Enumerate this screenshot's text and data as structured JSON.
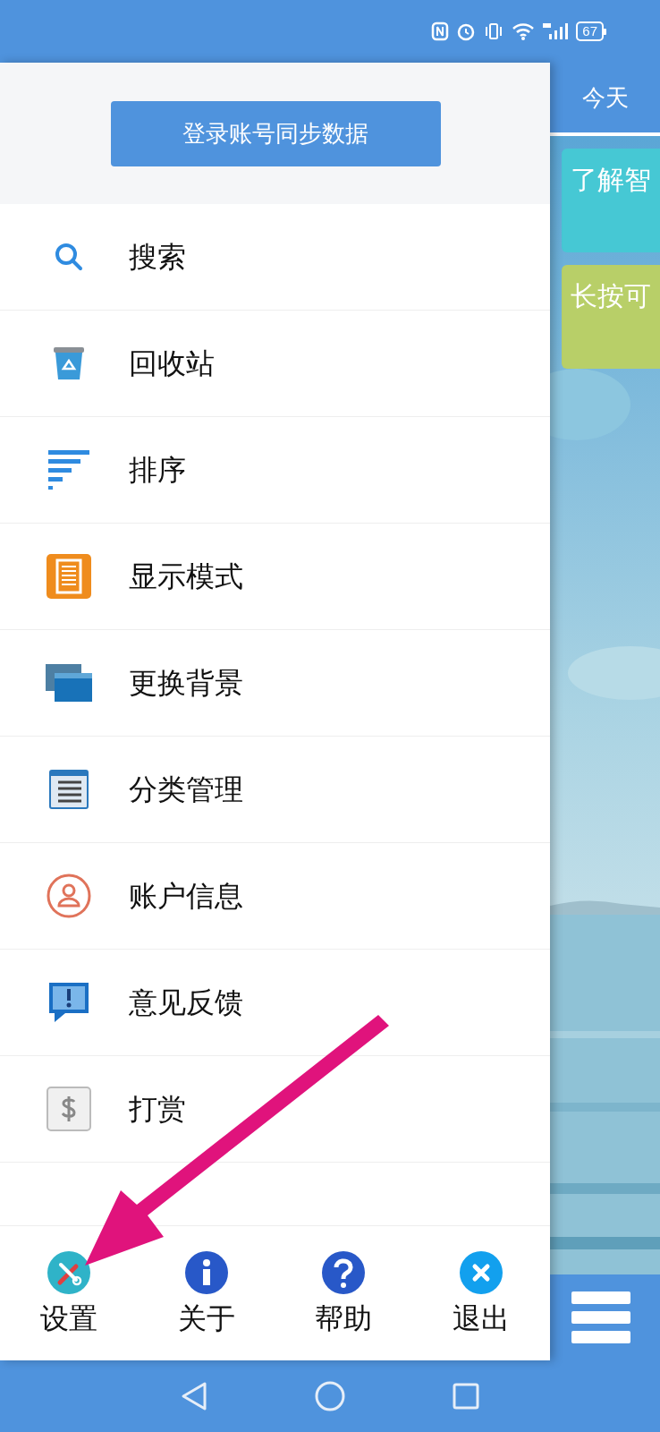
{
  "status_bar": {
    "battery": "67"
  },
  "drawer": {
    "login_button": "登录账号同步数据",
    "items": [
      {
        "kind": "search",
        "label": "搜索"
      },
      {
        "kind": "recycle",
        "label": "回收站"
      },
      {
        "kind": "sort",
        "label": "排序"
      },
      {
        "kind": "display",
        "label": "显示模式"
      },
      {
        "kind": "background",
        "label": "更换背景"
      },
      {
        "kind": "category",
        "label": "分类管理"
      },
      {
        "kind": "account",
        "label": "账户信息"
      },
      {
        "kind": "feedback",
        "label": "意见反馈"
      },
      {
        "kind": "reward",
        "label": "打赏"
      }
    ],
    "bottom_actions": [
      {
        "kind": "settings",
        "label": "设置"
      },
      {
        "kind": "about",
        "label": "关于"
      },
      {
        "kind": "help",
        "label": "帮助"
      },
      {
        "kind": "exit",
        "label": "退出"
      }
    ]
  },
  "main": {
    "tab": "今天",
    "notes": [
      {
        "text": "了解智",
        "color": "#46c8d4"
      },
      {
        "text": "长按可",
        "color": "#b8cf68"
      }
    ]
  }
}
